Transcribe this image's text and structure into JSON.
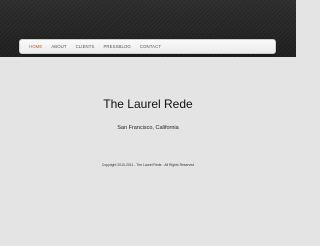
{
  "nav": {
    "items": [
      {
        "label": "HOME",
        "active": true
      },
      {
        "label": "ABOUT",
        "active": false
      },
      {
        "label": "CLIENTS",
        "active": false
      },
      {
        "label": "PRESSBLOG",
        "active": false
      },
      {
        "label": "CONTACT",
        "active": false
      }
    ]
  },
  "hero": {
    "title": "The Laurel Rede",
    "location": "San Francisco, California"
  },
  "footer": {
    "copyright": "Copyright 2010-2011 - The Laurel Rede - All Rights Reserved"
  },
  "colors": {
    "header_band": "#232323",
    "background": "#e4e4e4",
    "nav_active": "#c65a1e",
    "nav_text": "#555555"
  }
}
